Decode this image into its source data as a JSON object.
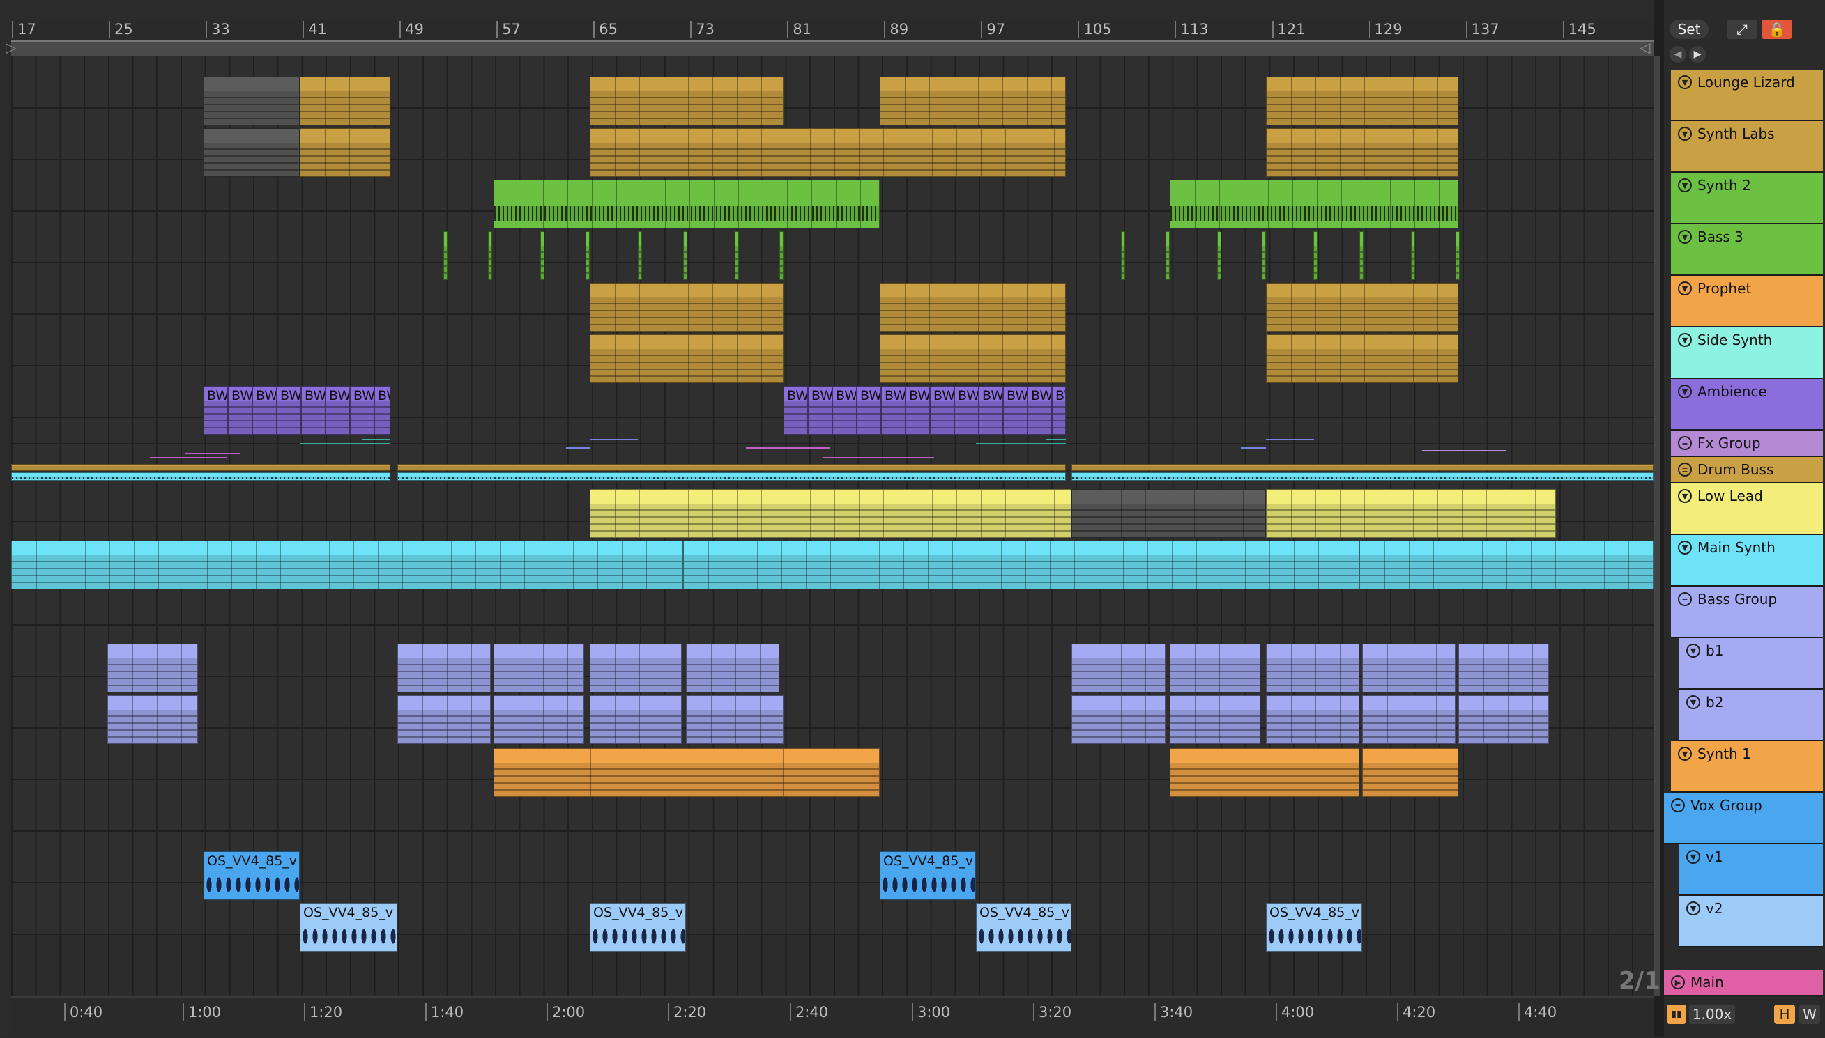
{
  "ruler": {
    "bars": [
      "17",
      "25",
      "33",
      "41",
      "49",
      "57",
      "65",
      "73",
      "81",
      "89",
      "97",
      "105",
      "113",
      "121",
      "129",
      "137",
      "145"
    ]
  },
  "timeline": {
    "times": [
      "0:40",
      "1:00",
      "1:20",
      "1:40",
      "2:00",
      "2:20",
      "2:40",
      "3:00",
      "3:20",
      "3:40",
      "4:00",
      "4:20",
      "4:40"
    ]
  },
  "topbar": {
    "set_label": "Set"
  },
  "tracks": [
    {
      "name": "Lounge Lizard",
      "color": "#c9a043",
      "type": "track"
    },
    {
      "name": "Synth Labs",
      "color": "#c9a043",
      "type": "track"
    },
    {
      "name": "Synth 2",
      "color": "#6cc142",
      "type": "track"
    },
    {
      "name": "Bass 3",
      "color": "#6cc142",
      "type": "track"
    },
    {
      "name": "Prophet",
      "color": "#f2a548",
      "type": "track"
    },
    {
      "name": "Side Synth",
      "color": "#8ef2e0",
      "type": "track"
    },
    {
      "name": "Ambience",
      "color": "#8a6fdc",
      "type": "track"
    },
    {
      "name": "Fx Group",
      "color": "#b48ad4",
      "type": "group"
    },
    {
      "name": "Drum Buss",
      "color": "#c9a043",
      "type": "group"
    },
    {
      "name": "Low Lead",
      "color": "#f3ee7a",
      "type": "track"
    },
    {
      "name": "Main Synth",
      "color": "#6ee2f6",
      "type": "track"
    },
    {
      "name": "Bass Group",
      "color": "#a4abf2",
      "type": "group"
    },
    {
      "name": "b1",
      "color": "#a4abf2",
      "type": "child"
    },
    {
      "name": "b2",
      "color": "#a4abf2",
      "type": "child"
    },
    {
      "name": "Synth 1",
      "color": "#f2a548",
      "type": "track"
    },
    {
      "name": "Vox Group",
      "color": "#4aa6ef",
      "type": "group"
    },
    {
      "name": "v1",
      "color": "#4aa6ef",
      "type": "child"
    },
    {
      "name": "v2",
      "color": "#9dcbf7",
      "type": "child"
    },
    {
      "name": "Main",
      "color": "#e060a6",
      "type": "main"
    }
  ],
  "clip_labels": {
    "ambience": "BW",
    "vox": "OS_VV4_85_v"
  },
  "footer": {
    "zoom": "1.00x",
    "h_btn": "H",
    "w_btn": "W"
  },
  "page_indicator": "2/1"
}
